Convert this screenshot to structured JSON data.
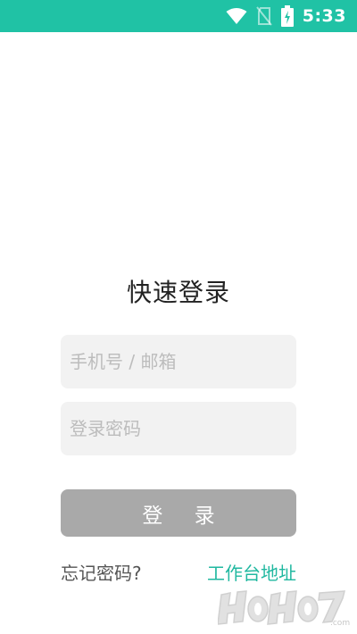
{
  "status_bar": {
    "time": "5:33",
    "background": "#20c2a5",
    "icons": [
      "wifi-icon",
      "no-sim-icon",
      "battery-charging-icon"
    ]
  },
  "login": {
    "title": "快速登录",
    "phone_placeholder": "手机号 / 邮箱",
    "password_placeholder": "登录密码",
    "login_button": "登 录",
    "forgot_password": "忘记密码?",
    "workbench_address": "工作台地址"
  },
  "colors": {
    "accent": "#20b8a0",
    "button_disabled": "#a9a9a9",
    "field_background": "#f2f2f2"
  }
}
